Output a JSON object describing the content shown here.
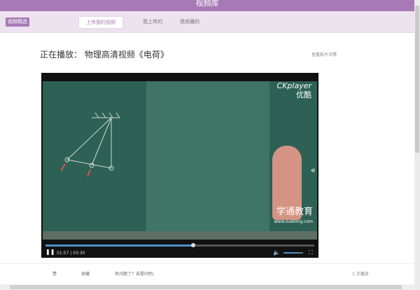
{
  "header": {
    "title": "视频库"
  },
  "subnav": {
    "badge": "视频精选",
    "tabs": [
      {
        "label": "上传我的视频"
      },
      {
        "label": "我上传的"
      },
      {
        "label": "我收藏的"
      }
    ]
  },
  "now_playing": {
    "text": "正在播放： 物理高清视频《电荷》",
    "detail_link": "查看影片详情"
  },
  "player": {
    "brand": "CKplayer",
    "brand_sub": "优酷",
    "watermark": "学通教育",
    "watermark_url": "www.xuetong.com",
    "time": "01:57 | 03:30",
    "progress": 0.55,
    "volume": 0.75
  },
  "actions": {
    "like": "赞",
    "favorite": "收藏",
    "question": "有问题了？去提问吧。",
    "plays": "1 次播放"
  },
  "colors": {
    "accent": "#a779b6",
    "board": "#2d6155"
  }
}
